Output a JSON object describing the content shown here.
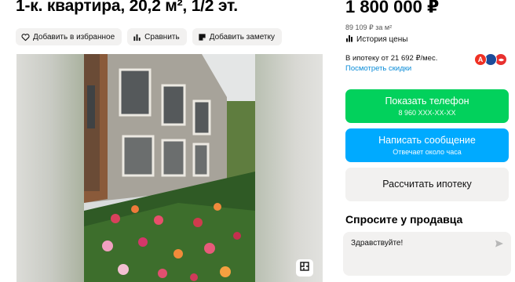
{
  "listing": {
    "title": "1-к. квартира, 20,2 м², 1/2 эт."
  },
  "actions": {
    "favorite": "Добавить в избранное",
    "compare": "Сравнить",
    "note": "Добавить заметку"
  },
  "pricing": {
    "price": "1 800 000 ₽",
    "per_sqm": "89 109 ₽ за м²",
    "history": "История цены",
    "mortgage": "В ипотеку от 21 692 ₽/мес.",
    "discounts": "Посмотреть скидки"
  },
  "banks": [
    {
      "letter": "А",
      "color": "#ef3124"
    },
    {
      "letter": "",
      "color": "#1c4c9b"
    },
    {
      "letter": "",
      "color": "#e8312f"
    }
  ],
  "contact": {
    "phone_label": "Показать телефон",
    "phone_number": "8 960 XXX-XX-XX",
    "message_label": "Написать сообщение",
    "message_sub": "Отвечает около часа",
    "mortgage_calc": "Рассчитать ипотеку"
  },
  "ask_seller": {
    "heading": "Спросите у продавца",
    "message": "Здравствуйте!"
  },
  "colors": {
    "green": "#02d15c",
    "blue": "#00aaff",
    "link": "#0a8cd8",
    "chip_bg": "#f2f1f0"
  },
  "icons": {
    "favorite": "heart-icon",
    "compare": "compare-bars-icon",
    "note": "note-icon",
    "history": "bar-chart-icon",
    "plan": "floor-plan-icon",
    "send": "send-icon"
  }
}
